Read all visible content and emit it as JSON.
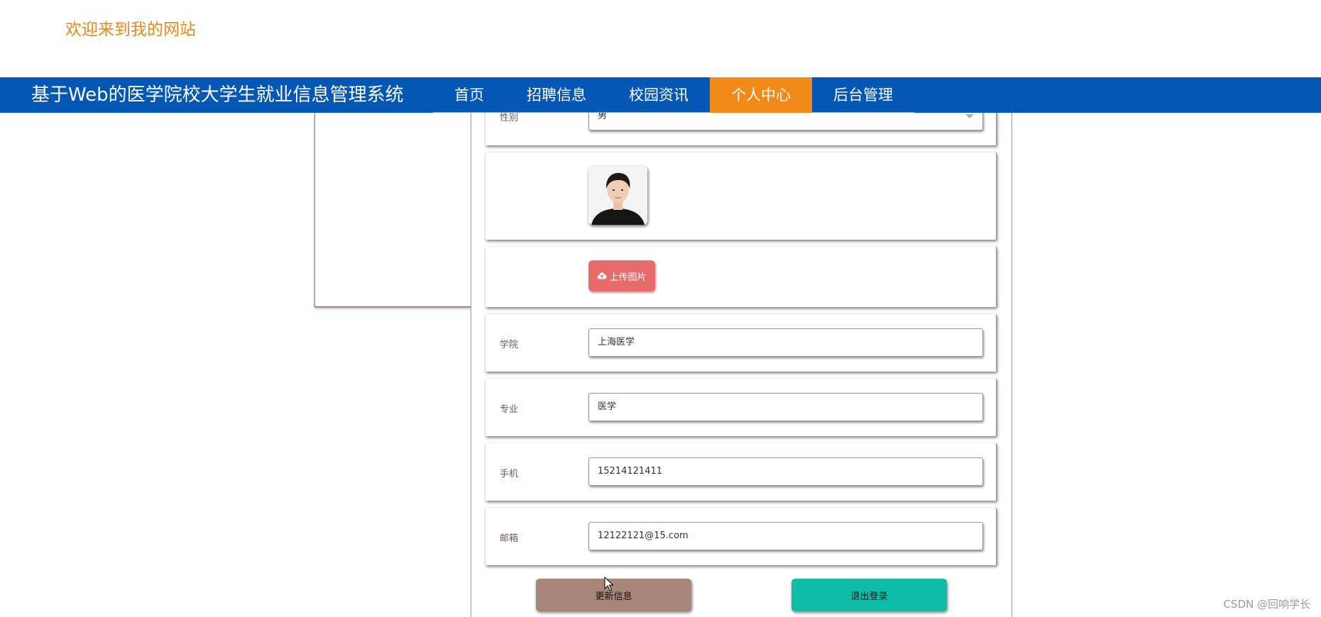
{
  "header": {
    "welcome": "欢迎来到我的网站"
  },
  "navbar": {
    "site_title": "基于Web的医学院校大学生就业信息管理系统",
    "items": [
      {
        "label": "首页"
      },
      {
        "label": "招聘信息"
      },
      {
        "label": "校园资讯"
      },
      {
        "label": "个人中心",
        "active": true
      },
      {
        "label": "后台管理"
      }
    ]
  },
  "form": {
    "gender": {
      "label": "性别",
      "value": "男"
    },
    "avatar": {
      "icon": "person-photo"
    },
    "upload": {
      "label": "上传图片",
      "icon": "cloud-upload-icon"
    },
    "college": {
      "label": "学院",
      "value": "上海医学"
    },
    "major": {
      "label": "专业",
      "value": "医学"
    },
    "phone": {
      "label": "手机",
      "value": "15214121411"
    },
    "email": {
      "label": "邮箱",
      "value": "12122121@15.com"
    }
  },
  "actions": {
    "update_label": "更新信息",
    "logout_label": "退出登录"
  },
  "watermark": "CSDN @回响学长",
  "colors": {
    "nav_bg": "#0557b5",
    "nav_active": "#f28a1a",
    "welcome_text": "#e8891e",
    "upload_btn": "#e86a6a",
    "update_btn": "#a88677",
    "logout_btn": "#0fbca8"
  }
}
